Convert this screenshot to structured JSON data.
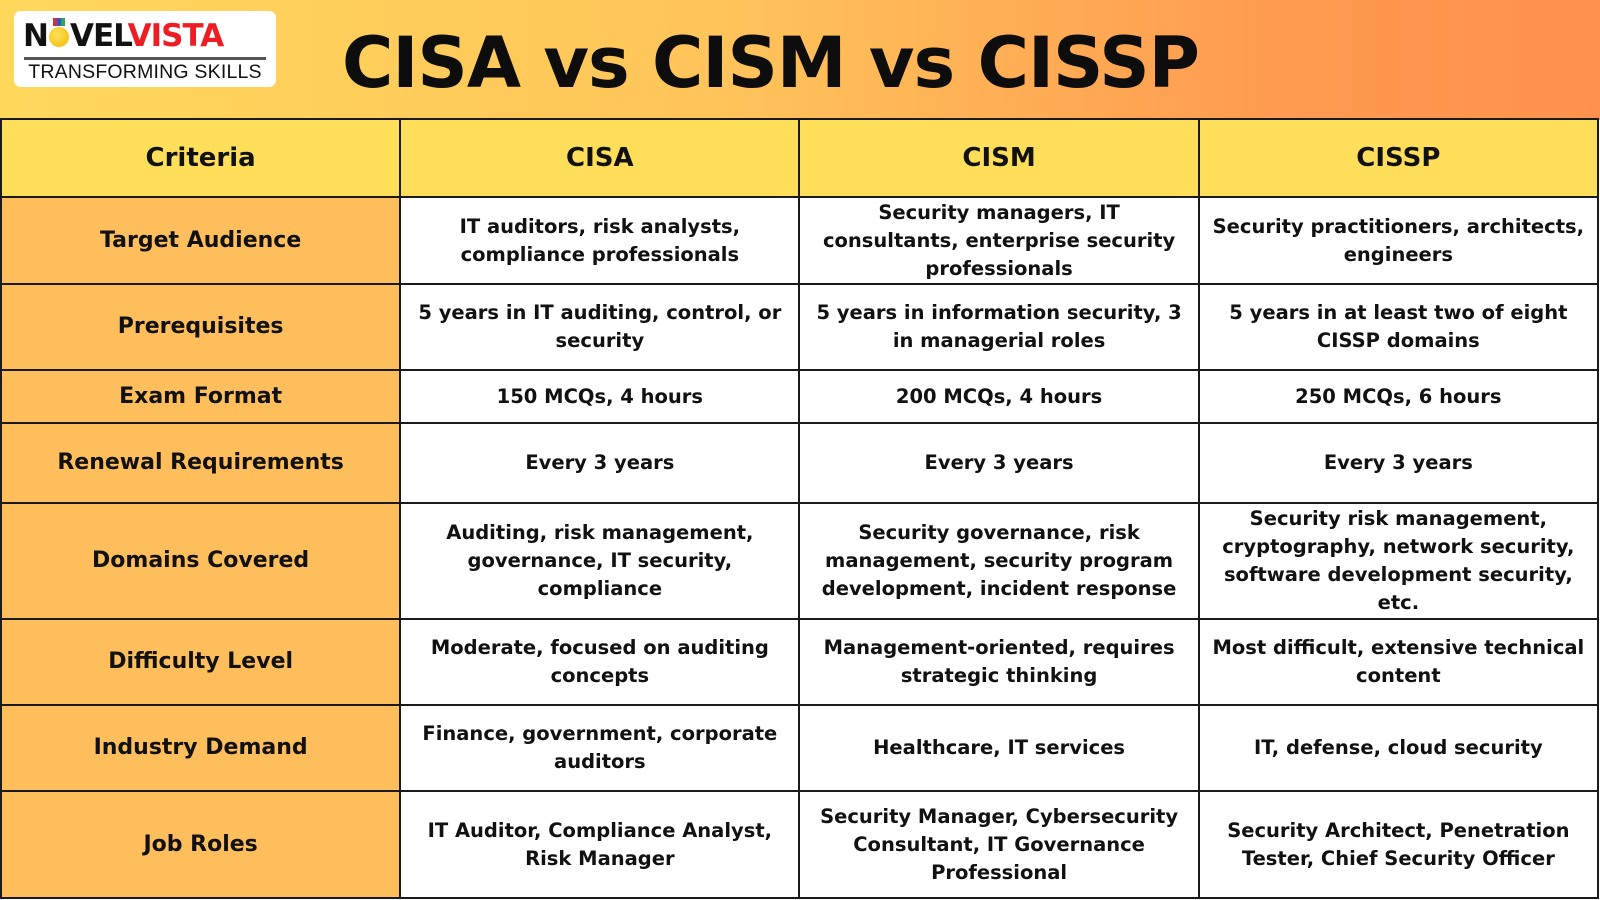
{
  "header": {
    "logo": {
      "word_part1": "N",
      "word_part2": "VEL",
      "word_part3": "VISTA",
      "tagline": "TRANSFORMING SKILLS"
    },
    "title": "CISA vs CISM vs CISSP"
  },
  "colors": {
    "banner_start": "#ffd85c",
    "banner_end": "#ff914d",
    "header_row": "#ffde59",
    "criteria_column": "#ffbe5c",
    "logo_red": "#ee1c24"
  },
  "table": {
    "columns": [
      "Criteria",
      "CISA",
      "CISM",
      "CISSP"
    ],
    "rows": [
      {
        "criteria": "Target Audience",
        "cisa": "IT auditors, risk analysts, compliance professionals",
        "cism": "Security managers, IT consultants, enterprise security professionals",
        "cissp": "Security practitioners, architects, engineers"
      },
      {
        "criteria": "Prerequisites",
        "cisa": "5 years in IT auditing, control, or security",
        "cism": "5 years in information security, 3 in managerial roles",
        "cissp": "5 years in at least two of eight CISSP domains"
      },
      {
        "criteria": "Exam Format",
        "cisa": "150 MCQs, 4 hours",
        "cism": "200 MCQs, 4 hours",
        "cissp": "250 MCQs, 6 hours"
      },
      {
        "criteria": "Renewal Requirements",
        "cisa": "Every 3 years",
        "cism": "Every 3 years",
        "cissp": "Every 3 years"
      },
      {
        "criteria": "Domains Covered",
        "cisa": "Auditing, risk management, governance, IT security, compliance",
        "cism": "Security governance, risk management, security program development, incident response",
        "cissp": "Security risk management, cryptography, network security, software development security, etc."
      },
      {
        "criteria": "Difficulty Level",
        "cisa": "Moderate, focused on auditing concepts",
        "cism": "Management-oriented, requires strategic thinking",
        "cissp": "Most difficult, extensive technical content"
      },
      {
        "criteria": "Industry Demand",
        "cisa": "Finance, government, corporate auditors",
        "cism": "Healthcare, IT services",
        "cissp": "IT, defense, cloud security"
      },
      {
        "criteria": "Job Roles",
        "cisa": "IT Auditor, Compliance Analyst, Risk Manager",
        "cism": "Security Manager, Cybersecurity Consultant, IT Governance Professional",
        "cissp": "Security Architect, Penetration Tester, Chief Security Officer"
      }
    ]
  }
}
